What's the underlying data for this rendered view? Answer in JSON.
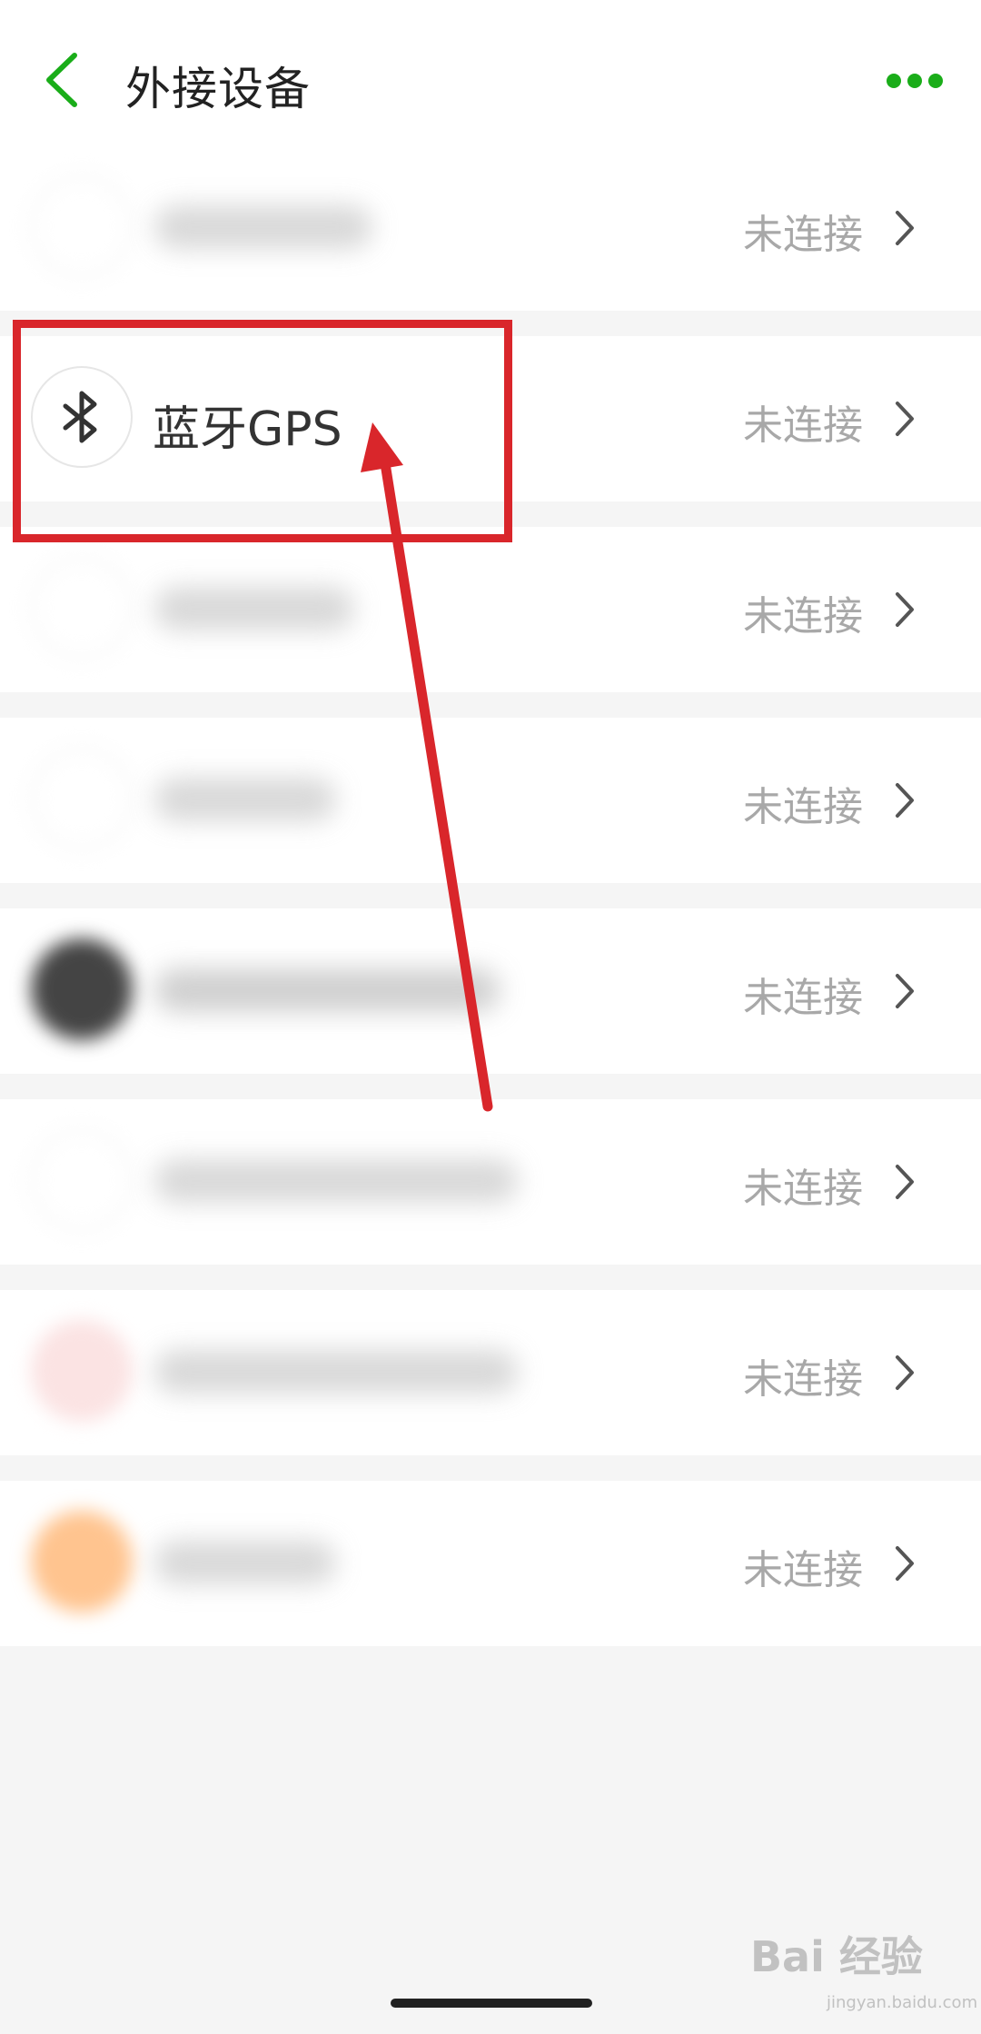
{
  "header": {
    "title": "外接设备",
    "back_icon": "chevron-left-icon",
    "more_icon": "more-dots-icon",
    "accent_color": "#1aad19"
  },
  "devices": [
    {
      "name": "",
      "status": "未连接",
      "blurred": true
    },
    {
      "name": "蓝牙GPS",
      "status": "未连接",
      "blurred": false,
      "icon": "bluetooth-icon"
    },
    {
      "name": "",
      "status": "未连接",
      "blurred": true
    },
    {
      "name": "",
      "status": "未连接",
      "blurred": true
    },
    {
      "name": "",
      "status": "未连接",
      "blurred": true
    },
    {
      "name": "",
      "status": "未连接",
      "blurred": true
    },
    {
      "name": "",
      "status": "未连接",
      "blurred": true
    },
    {
      "name": "",
      "status": "未连接",
      "blurred": true
    }
  ],
  "annotation": {
    "highlight_color": "#d9262b"
  },
  "watermark": {
    "text": "Bai 经验",
    "sub": "jingyan.baidu.com"
  }
}
